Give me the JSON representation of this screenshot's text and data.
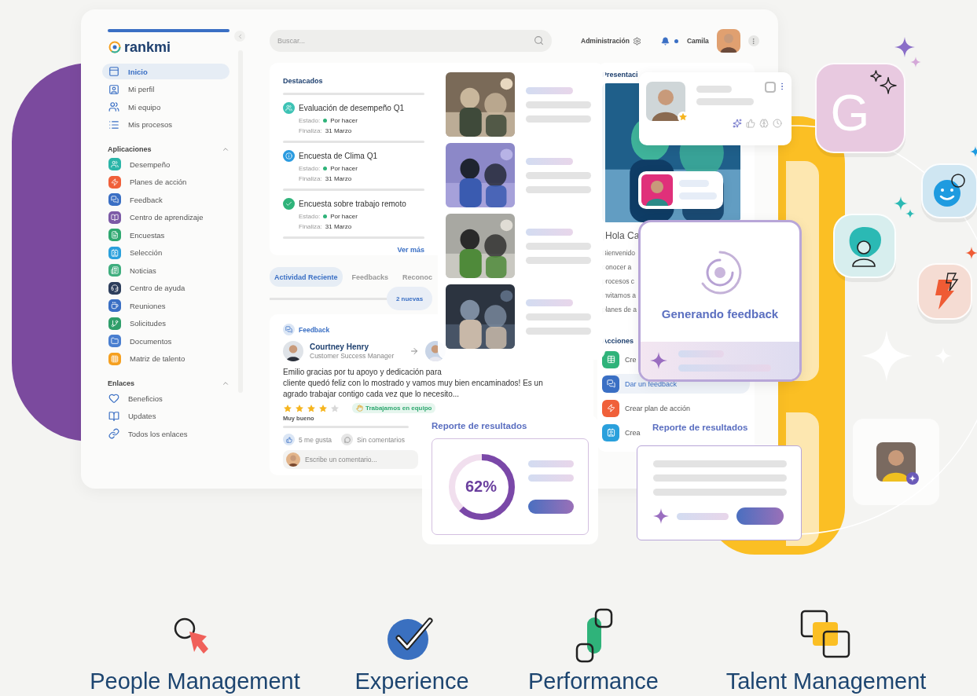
{
  "sidebar": {
    "logo": "rankmi",
    "nav": [
      {
        "label": "Inicio",
        "selected": true
      },
      {
        "label": "Mi perfil",
        "selected": false
      },
      {
        "label": "Mi equipo",
        "selected": false
      },
      {
        "label": "Mis procesos",
        "selected": false
      }
    ],
    "sections": [
      {
        "title": "Aplicaciones",
        "expanded": true,
        "items": [
          {
            "label": "Desempeño",
            "color": "#2bb5a8"
          },
          {
            "label": "Planes de acción",
            "color": "#f0603a"
          },
          {
            "label": "Feedback",
            "color": "#3a6fc4"
          },
          {
            "label": "Centro de aprendizaje",
            "color": "#7c5aa6"
          },
          {
            "label": "Encuestas",
            "color": "#2fa870"
          },
          {
            "label": "Selección",
            "color": "#2aa0dc"
          },
          {
            "label": "Noticias",
            "color": "#3fae7e"
          },
          {
            "label": "Centro de ayuda",
            "color": "#2d3e5c"
          },
          {
            "label": "Reuniones",
            "color": "#3a6fc4"
          },
          {
            "label": "Solicitudes",
            "color": "#2f9e6a"
          },
          {
            "label": "Documentos",
            "color": "#4a7fd0"
          },
          {
            "label": "Matriz de talento",
            "color": "#f5a020"
          }
        ]
      },
      {
        "title": "Enlaces",
        "expanded": true,
        "items": [
          {
            "label": "Beneficios"
          },
          {
            "label": "Updates"
          },
          {
            "label": "Todos los enlaces"
          }
        ]
      }
    ]
  },
  "header": {
    "search_placeholder": "Buscar...",
    "admin": "Administración",
    "notifications_unread": true,
    "user": "Camila"
  },
  "highlights": {
    "title": "Destacados",
    "items": [
      {
        "title": "Evaluación de desempeño Q1",
        "status_label": "Estado:",
        "status": "Por hacer",
        "end_label": "Finaliza:",
        "end": "31 Marzo",
        "color": "#3cc2b4"
      },
      {
        "title": "Encuesta de Clima Q1",
        "status_label": "Estado:",
        "status": "Por hacer",
        "end_label": "Finaliza:",
        "end": "31 Marzo",
        "color": "#2a9be0"
      },
      {
        "title": "Encuesta sobre trabajo remoto",
        "status_label": "Estado:",
        "status": "Por hacer",
        "end_label": "Finaliza:",
        "end": "31 Marzo",
        "color": "#2fb37a"
      }
    ],
    "more": "Ver más"
  },
  "activity": {
    "tabs": [
      {
        "label": "Actividad Reciente",
        "selected": true
      },
      {
        "label": "Feedbacks",
        "selected": false
      },
      {
        "label": "Reconoc",
        "selected": false
      }
    ],
    "new_badge": "2 nuevas",
    "post": {
      "type": "Feedback",
      "author": "Courtney Henry",
      "role": "Customer Success Manager",
      "lines": [
        "Emilio gracias por tu apoyo y dedicación para",
        "cliente quedó feliz con lo mostrado y vamos muy bien encaminados! Es un",
        "agrado trabajar contigo cada vez que lo necesito..."
      ],
      "stars": 4,
      "rating": "Muy bueno",
      "tag": "Trabajamos en equipo",
      "likes": "5 me gusta",
      "comments": "Sin comentarios",
      "comment_placeholder": "Escribe un comentario..."
    }
  },
  "presentation": {
    "title": "Presentaci",
    "greeting": "¡Hola Ca",
    "lines": [
      "Bienvenido",
      "conocer a",
      "procesos c",
      "invitamos a",
      "planes de a"
    ]
  },
  "actions": {
    "title": "Acciones",
    "items": [
      {
        "label": "Cre",
        "color": "#2fb37a",
        "selected": false
      },
      {
        "label": "Dar un feedback",
        "color": "#3a6fc4",
        "selected": true
      },
      {
        "label": "Crear plan de acción",
        "color": "#f0603a",
        "selected": false
      },
      {
        "label": "Crea",
        "color": "#2aa0dc",
        "selected": false
      }
    ]
  },
  "profile_card": {
    "checked": false
  },
  "report_left": {
    "title": "Reporte de resultados",
    "percent": "62%",
    "level": 0.62
  },
  "generating": {
    "title": "Generando feedback"
  },
  "report_right": {
    "title": "Reporte de resultados"
  },
  "tiles": [
    {
      "kind": "letter",
      "text": "G"
    },
    {
      "kind": "smile"
    },
    {
      "kind": "brain"
    },
    {
      "kind": "bolt"
    }
  ],
  "features": [
    {
      "label": "People Management"
    },
    {
      "label": "Experience"
    },
    {
      "label": "Performance"
    },
    {
      "label": "Talent Management"
    }
  ]
}
